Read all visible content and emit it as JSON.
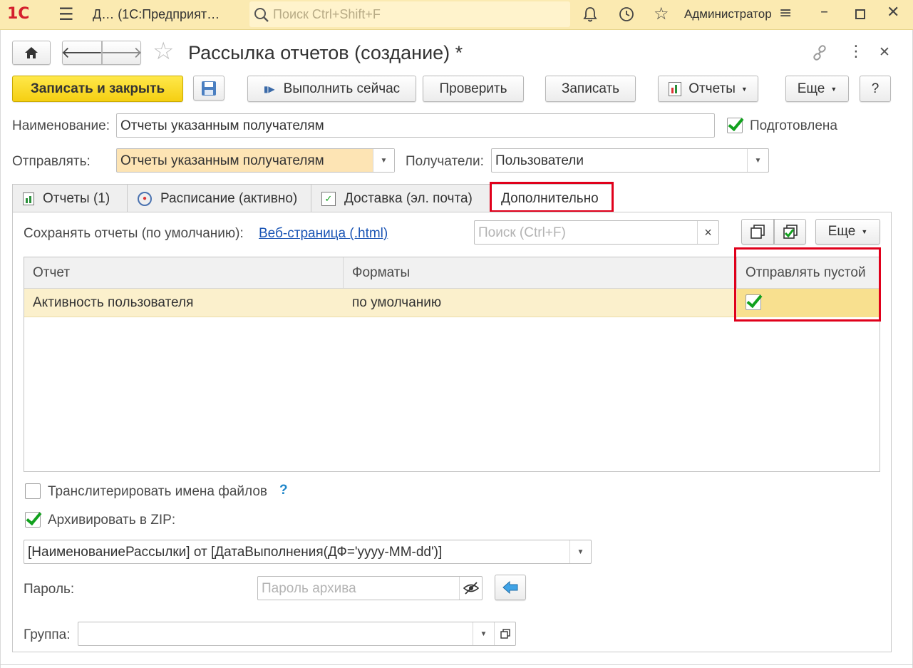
{
  "topbar": {
    "logo": "1С",
    "menu_icon": "menu-icon",
    "tab_text": "Д…  (1С:Предприят…",
    "search_placeholder": "Поиск Ctrl+Shift+F",
    "user": "Администратор"
  },
  "header": {
    "title": "Рассылка отчетов (создание) *"
  },
  "toolbar": {
    "save_close": "Записать и закрыть",
    "run_now": "Выполнить сейчас",
    "check": "Проверить",
    "save": "Записать",
    "reports": "Отчеты",
    "more": "Еще",
    "help": "?"
  },
  "form": {
    "name_label": "Наименование:",
    "name_value": "Отчеты указанным получателям",
    "prepared_label": "Подготовлена",
    "send_label": "Отправлять:",
    "send_value": "Отчеты указанным получателям",
    "recipients_label": "Получатели:",
    "recipients_value": "Пользователи"
  },
  "tabs": [
    {
      "label": "Отчеты (1)",
      "icon": "report-icon"
    },
    {
      "label": "Расписание (активно)",
      "icon": "clock-icon"
    },
    {
      "label": "Доставка (эл. почта)",
      "icon": "delivery-icon"
    },
    {
      "label": "Дополнительно",
      "icon": ""
    }
  ],
  "panel": {
    "save_default_label": "Сохранять отчеты (по умолчанию):",
    "save_default_link": "Веб-страница (.html)",
    "search_placeholder": "Поиск (Ctrl+F)",
    "search_clear": "×",
    "more": "Еще",
    "columns": [
      "Отчет",
      "Форматы",
      "Отправлять пустой"
    ],
    "rows": [
      {
        "report": "Активность пользователя",
        "formats": "по умолчанию",
        "send_empty": true
      }
    ],
    "transliterate_label": "Транслитерировать имена файлов",
    "help_mark": "?",
    "zip_label": "Архивировать в ZIP:",
    "zip_template": "[НаименованиеРассылки] от [ДатаВыполнения(ДФ='yyyy-MM-dd')]",
    "password_label": "Пароль:",
    "password_placeholder": "Пароль архива",
    "group_label": "Группа:",
    "group_value": ""
  },
  "colors": {
    "topbar": "#fbeab1",
    "primary_button": "#f5cf12",
    "highlight": "#e0001b",
    "selected_row": "#fbf0cc",
    "check": "#12a11e"
  }
}
